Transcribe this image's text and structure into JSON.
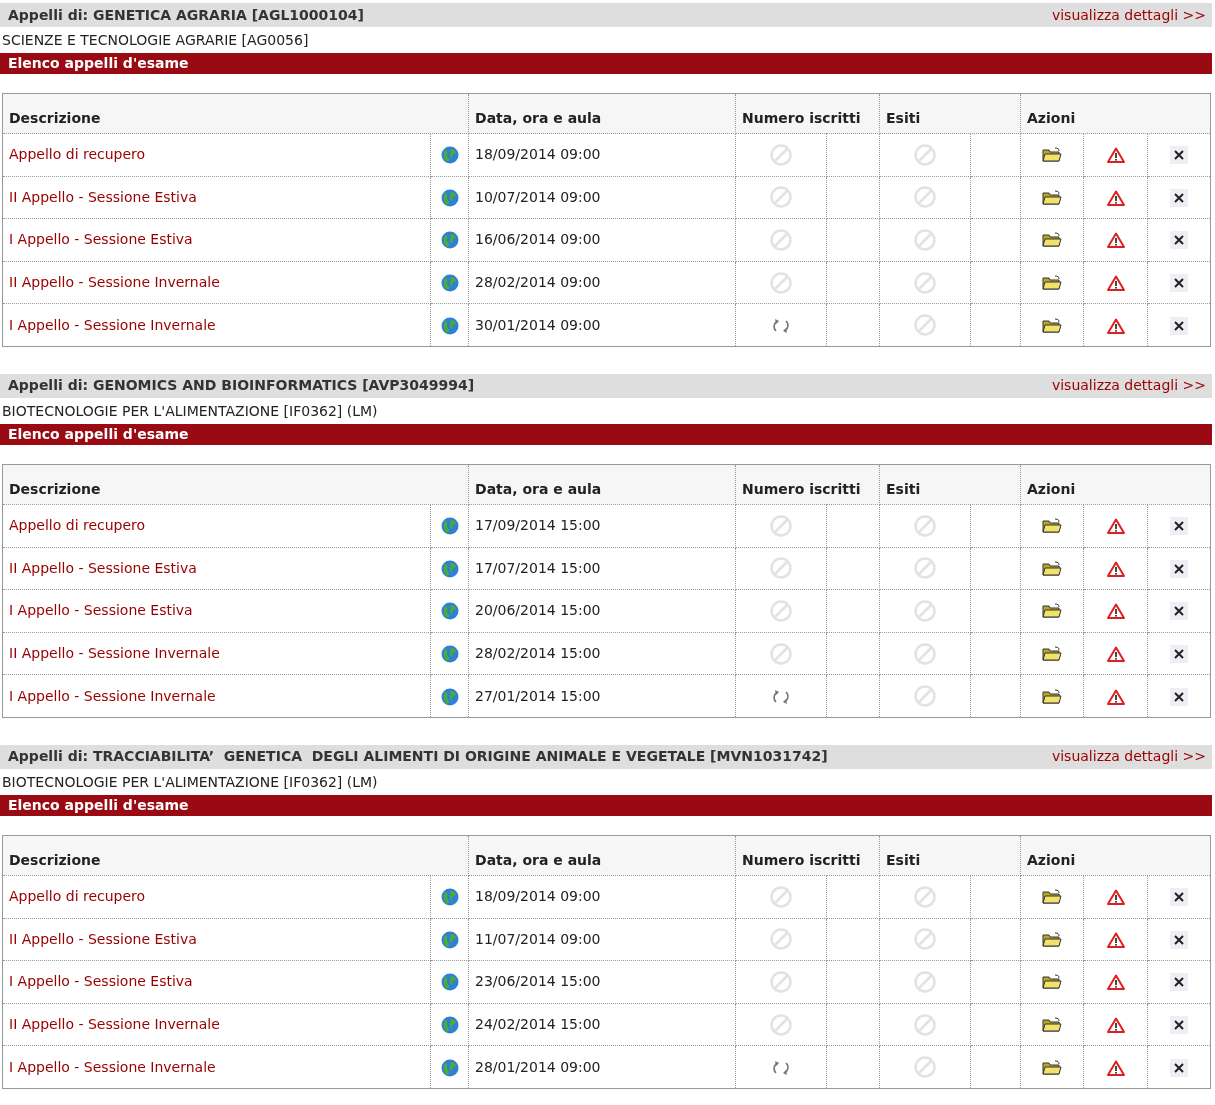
{
  "sections": [
    {
      "title": "Appelli di: GENETICA AGRARIA [AGL1000104]",
      "details_link": "visualizza dettagli >>",
      "course": "SCIENZE E TECNOLOGIE AGRARIE [AG0056]",
      "list_title": "Elenco appelli d'esame",
      "columns": [
        "Descrizione",
        "Data, ora e aula",
        "Numero iscritti",
        "Esiti",
        "Azioni"
      ],
      "rows": [
        {
          "description": "Appello di recupero",
          "date": "18/09/2014 09:00",
          "kind": "none"
        },
        {
          "description": "II Appello - Sessione Estiva",
          "date": "10/07/2014 09:00",
          "kind": "none"
        },
        {
          "description": "I Appello - Sessione Estiva",
          "date": "16/06/2014 09:00",
          "kind": "none"
        },
        {
          "description": "II Appello - Sessione Invernale",
          "date": "28/02/2014 09:00",
          "kind": "none"
        },
        {
          "description": "I Appello - Sessione Invernale",
          "date": "30/01/2014 09:00",
          "kind": "refresh"
        }
      ]
    },
    {
      "title": "Appelli di: GENOMICS AND BIOINFORMATICS [AVP3049994]",
      "details_link": "visualizza dettagli >>",
      "course": "BIOTECNOLOGIE PER L'ALIMENTAZIONE [IF0362] (LM)",
      "list_title": "Elenco appelli d'esame",
      "columns": [
        "Descrizione",
        "Data, ora e aula",
        "Numero iscritti",
        "Esiti",
        "Azioni"
      ],
      "rows": [
        {
          "description": "Appello di recupero",
          "date": "17/09/2014 15:00",
          "kind": "none"
        },
        {
          "description": "II Appello - Sessione Estiva",
          "date": "17/07/2014 15:00",
          "kind": "none"
        },
        {
          "description": "I Appello - Sessione Estiva",
          "date": "20/06/2014 15:00",
          "kind": "none"
        },
        {
          "description": "II Appello - Sessione Invernale",
          "date": "28/02/2014 15:00",
          "kind": "none"
        },
        {
          "description": "I Appello - Sessione Invernale",
          "date": "27/01/2014 15:00",
          "kind": "refresh"
        }
      ]
    },
    {
      "title": "Appelli di: TRACCIABILITA’  GENETICA  DEGLI ALIMENTI DI ORIGINE ANIMALE E VEGETALE [MVN1031742]",
      "details_link": "visualizza dettagli >>",
      "course": "BIOTECNOLOGIE PER L'ALIMENTAZIONE [IF0362] (LM)",
      "list_title": "Elenco appelli d'esame",
      "columns": [
        "Descrizione",
        "Data, ora e aula",
        "Numero iscritti",
        "Esiti",
        "Azioni"
      ],
      "rows": [
        {
          "description": "Appello di recupero",
          "date": "18/09/2014 09:00",
          "kind": "none"
        },
        {
          "description": "II Appello - Sessione Estiva",
          "date": "11/07/2014 09:00",
          "kind": "none"
        },
        {
          "description": "I Appello - Sessione Estiva",
          "date": "23/06/2014 15:00",
          "kind": "none"
        },
        {
          "description": "II Appello - Sessione Invernale",
          "date": "24/02/2014 15:00",
          "kind": "none"
        },
        {
          "description": "I Appello - Sessione Invernale",
          "date": "28/01/2014 09:00",
          "kind": "refresh"
        }
      ]
    }
  ]
}
